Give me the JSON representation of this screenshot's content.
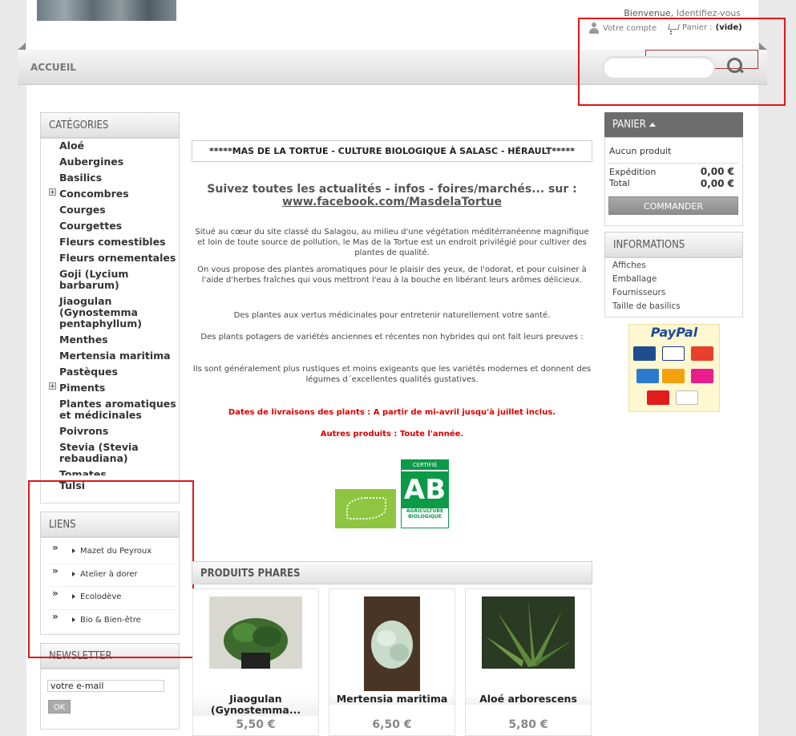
{
  "header": {
    "welcome": "Bienvenue,",
    "login": "Identifiez-vous",
    "account": "Votre compte",
    "cart": "Panier :",
    "cart_state": "(vide)"
  },
  "nav": {
    "home": "ACCUEIL",
    "search_placeholder": ""
  },
  "categories": {
    "title": "CATÉGORIES",
    "items": [
      "Aloé",
      "Aubergines",
      "Basilics",
      "Concombres",
      "Courges",
      "Courgettes",
      "Fleurs comestibles",
      "Fleurs ornementales",
      "Goji (Lycium barbarum)",
      "Jiaogulan (Gynostemma pentaphyllum)",
      "Menthes",
      "Mertensia maritima",
      "Pastèques",
      "Piments",
      "Plantes aromatiques et médicinales",
      "Poivrons",
      "Stevia (Stevia rebaudiana)",
      "Tomates",
      "Tulsi"
    ]
  },
  "links": {
    "title": "LIENS",
    "items": [
      "Mazet du Peyroux",
      "Atelier à dorer",
      "Ecolodève",
      "Bio & Bien-être"
    ]
  },
  "newsletter": {
    "title": "NEWSLETTER",
    "value": "votre e-mail",
    "ok": "OK"
  },
  "main": {
    "banner": "*****MAS DE LA TORTUE - CULTURE BIOLOGIQUE À SALASC - HÉRAULT*****",
    "follow": "Suivez toutes les actualités - infos - foires/marchés... sur :",
    "facebook": "www.facebook.com/MasdelaTortue",
    "p1": "Situé au cœur du site classé du Salagou, au milieu d'une végétation méditérranéenne magnifique et loin de toute source de pollution, le Mas de la Tortue est un endroit privilégié pour cultiver des plantes de qualité.",
    "p2": "On vous propose des plantes aromatiques pour le plaisir des yeux, de l'odorat, et pour cuisiner à l'aide d'herbes fraîches qui vous mettront l'eau à la bouche en libérant leurs arômes délicieux.",
    "p3": "Des plantes aux vertus médicinales pour entretenir naturellement votre santé.",
    "p4": "Des plants potagers de variétés anciennes et récentes non hybrides qui ont fait leurs preuves :",
    "p5": "Ils sont généralement plus rustiques et moins exigeants que les variétés modernes et donnent des légumes d´excellentes qualités gustatives.",
    "dates": "Dates de livraisons des plants : A partir de mi-avril jusqu'à juillet inclus.",
    "others": "Autres produits : Toute l'année.",
    "ab_cert": "CERTIFIÉ",
    "ab": "AB",
    "ab_sub": "AGRICULTURE BIOLOGIQUE"
  },
  "featured": {
    "title": "PRODUITS PHARES",
    "products": [
      {
        "name": "Jiaogulan (Gynostemma...",
        "price": "5,50 €"
      },
      {
        "name": "Mertensia maritima",
        "price": "6,50 €"
      },
      {
        "name": "Aloé arborescens",
        "price": "5,80 €"
      }
    ]
  },
  "panier": {
    "title": "PANIER",
    "empty": "Aucun produit",
    "shipping_label": "Expédition",
    "shipping": "0,00 €",
    "total_label": "Total",
    "total": "0,00 €",
    "order": "COMMANDER"
  },
  "informations": {
    "title": "INFORMATIONS",
    "items": [
      "Affiches",
      "Emballage",
      "Fournisseurs",
      "Taille de basilics"
    ]
  },
  "paypal": {
    "brand": "PayPal"
  },
  "colors": {
    "highlight": "#e01818",
    "cart_header": "#6d6d6d",
    "price_red": "#dd0000"
  }
}
